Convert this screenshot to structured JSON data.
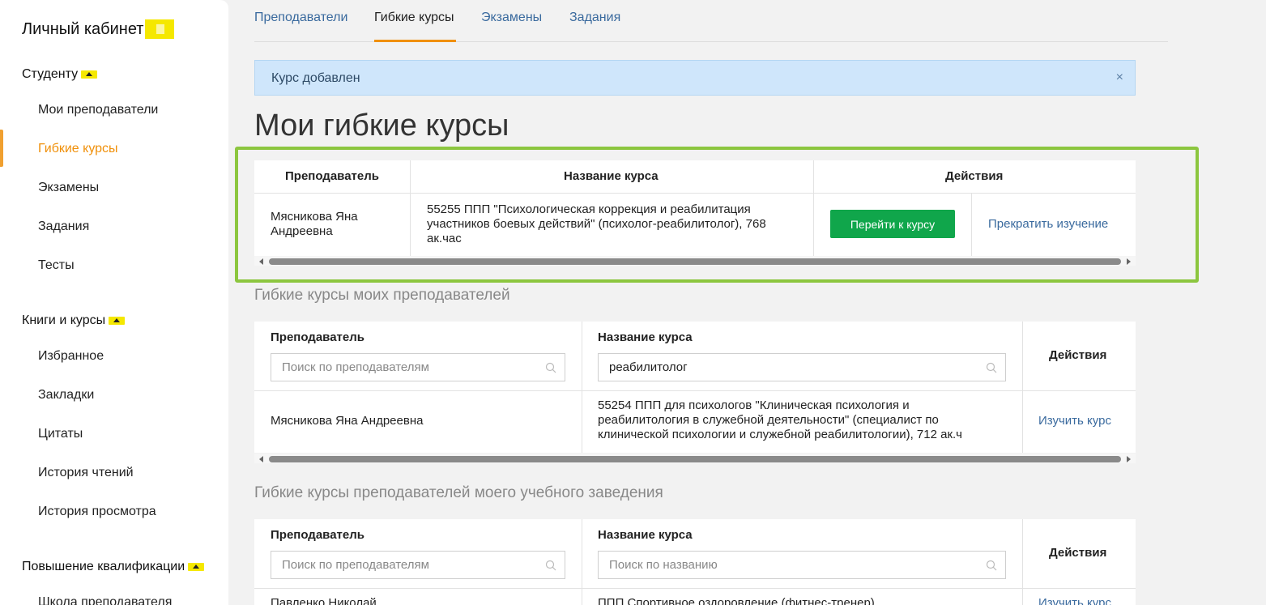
{
  "sidebar": {
    "title": "Личный кабинет",
    "sections": [
      {
        "label": "Студенту",
        "items": [
          "Мои преподаватели",
          "Гибкие курсы",
          "Экзамены",
          "Задания",
          "Тесты"
        ]
      },
      {
        "label": "Книги и курсы",
        "items": [
          "Избранное",
          "Закладки",
          "Цитаты",
          "История чтений",
          "История просмотра"
        ]
      },
      {
        "label": "Повышение квалификации",
        "items": [
          "Школа преподавателя"
        ]
      }
    ],
    "active_item": "Гибкие курсы"
  },
  "tabs": [
    "Преподаватели",
    "Гибкие курсы",
    "Экзамены",
    "Задания"
  ],
  "active_tab": "Гибкие курсы",
  "alert": {
    "text": "Курс добавлен",
    "close": "×"
  },
  "page_title": "Мои гибкие курсы",
  "my_courses": {
    "headers": {
      "teacher": "Преподаватель",
      "course": "Название курса",
      "actions": "Действия"
    },
    "rows": [
      {
        "teacher_line1": "Мясникова Яна",
        "teacher_line2": "Андреевна",
        "course_line1": "55255 ППП \"Психологическая коррекция и реабилитация",
        "course_line2": "участников боевых действий\" (психолог-реабилитолог), 768",
        "course_line3": "ак.час",
        "go_button": "Перейти к курсу",
        "stop_link": "Прекратить изучение"
      }
    ]
  },
  "teachers_courses": {
    "title": "Гибкие курсы моих преподавателей",
    "headers": {
      "teacher": "Преподаватель",
      "course": "Название курса",
      "actions": "Действия"
    },
    "teacher_search_placeholder": "Поиск по преподавателям",
    "course_search_value": "реабилитолог",
    "rows": [
      {
        "teacher": "Мясникова Яна Андреевна",
        "course_line1": "55254 ППП для психологов \"Клиническая психология и",
        "course_line2": "реабилитология в служебной деятельности\" (специалист по",
        "course_line3": "клинической психологии и служебной реабилитологии), 712 ак.ч",
        "action": "Изучить курс"
      }
    ]
  },
  "school_courses": {
    "title": "Гибкие курсы преподавателей моего учебного заведения",
    "headers": {
      "teacher": "Преподаватель",
      "course": "Название курса",
      "actions": "Действия"
    },
    "teacher_search_placeholder": "Поиск по преподавателям",
    "course_search_placeholder": "Поиск по названию",
    "rows": [
      {
        "teacher": "Павленко Николай",
        "course": "ППП Спортивное оздоровление (фитнес-тренер)",
        "action": "Изучить курс"
      }
    ]
  },
  "colors": {
    "accent": "#f0900a",
    "link": "#3a6a9e",
    "button_green": "#10a64b",
    "highlight": "#8cc63f",
    "alert_bg": "#cfe6fb"
  }
}
